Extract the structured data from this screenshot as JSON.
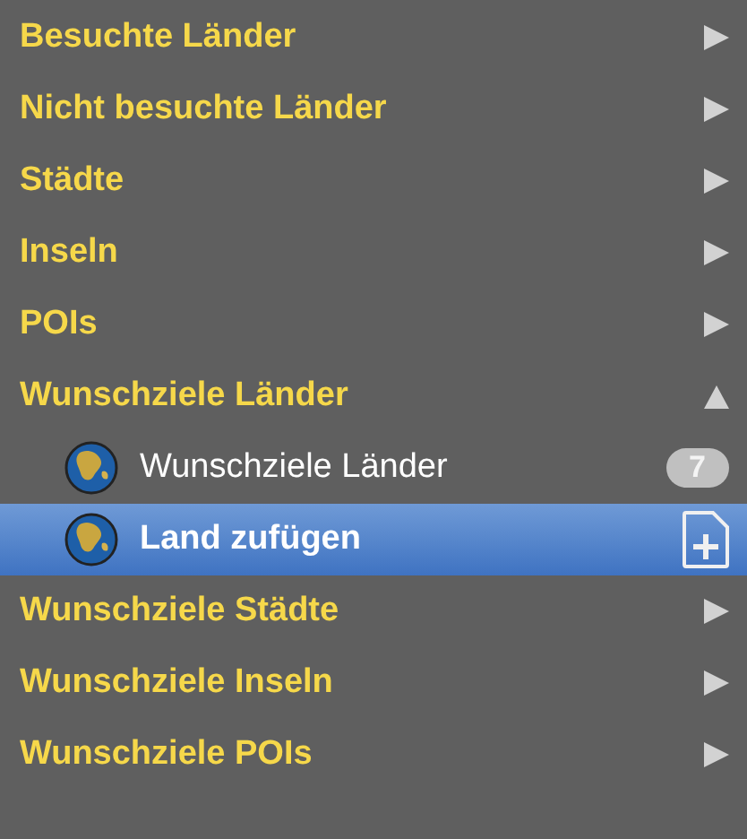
{
  "sections": [
    {
      "label": "Besuchte Länder",
      "expanded": false
    },
    {
      "label": "Nicht besuchte Länder",
      "expanded": false
    },
    {
      "label": "Städte",
      "expanded": false
    },
    {
      "label": "Inseln",
      "expanded": false
    },
    {
      "label": "POIs",
      "expanded": false
    },
    {
      "label": "Wunschziele Länder",
      "expanded": true,
      "children": [
        {
          "label": "Wunschziele Länder",
          "kind": "count",
          "badge": "7",
          "selected": false
        },
        {
          "label": "Land zufügen",
          "kind": "add",
          "selected": true
        }
      ]
    },
    {
      "label": "Wunschziele Städte",
      "expanded": false
    },
    {
      "label": "Wunschziele Inseln",
      "expanded": false
    },
    {
      "label": "Wunschziele POIs",
      "expanded": false
    }
  ]
}
